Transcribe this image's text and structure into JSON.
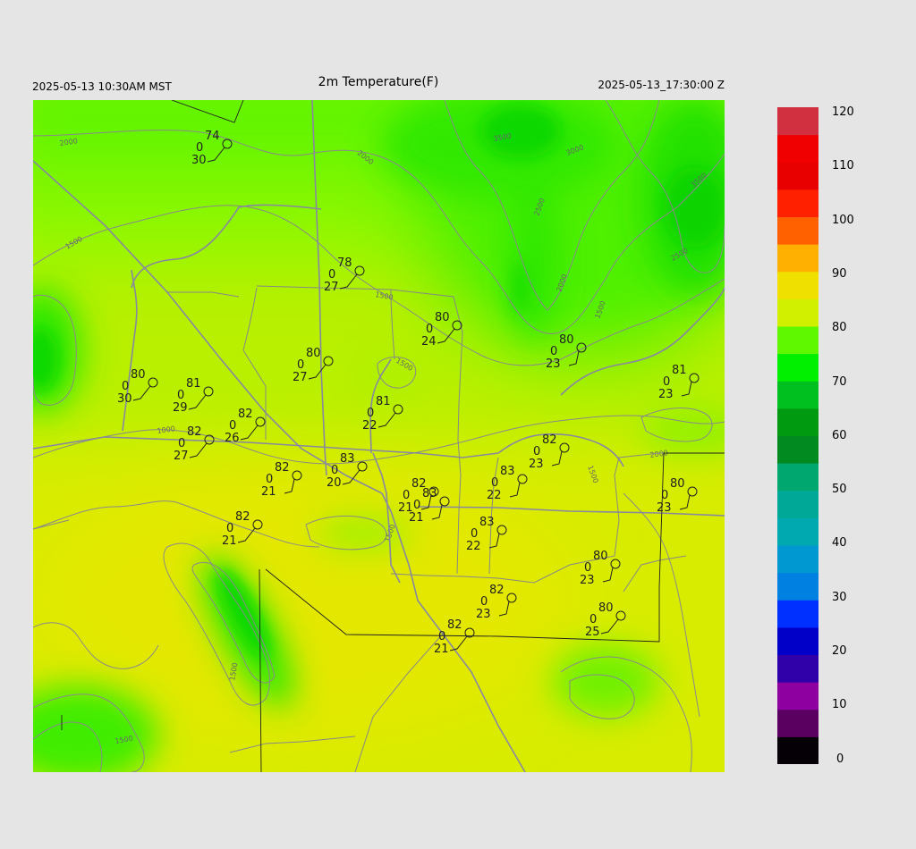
{
  "header": {
    "title": "2m Temperature(F)",
    "local_time": "2025-05-13 10:30AM MST",
    "utc_time": "2025-05-13_17:30:00 Z"
  },
  "colorbar": {
    "labels": [
      "120",
      "110",
      "100",
      "90",
      "80",
      "70",
      "60",
      "50",
      "40",
      "30",
      "20",
      "10",
      "0"
    ],
    "stops": [
      {
        "v": 0,
        "c": "#050005"
      },
      {
        "v": 5,
        "c": "#5a0060"
      },
      {
        "v": 10,
        "c": "#8e00a0"
      },
      {
        "v": 15,
        "c": "#3000a8"
      },
      {
        "v": 20,
        "c": "#0000c8"
      },
      {
        "v": 25,
        "c": "#0030ff"
      },
      {
        "v": 30,
        "c": "#0080e0"
      },
      {
        "v": 35,
        "c": "#0098d0"
      },
      {
        "v": 40,
        "c": "#00a8b0"
      },
      {
        "v": 45,
        "c": "#00a898"
      },
      {
        "v": 50,
        "c": "#00a870"
      },
      {
        "v": 55,
        "c": "#008a20"
      },
      {
        "v": 60,
        "c": "#009a10"
      },
      {
        "v": 65,
        "c": "#00c020"
      },
      {
        "v": 70,
        "c": "#00f000"
      },
      {
        "v": 75,
        "c": "#60f800"
      },
      {
        "v": 80,
        "c": "#d0f000"
      },
      {
        "v": 85,
        "c": "#f0e000"
      },
      {
        "v": 90,
        "c": "#ffb000"
      },
      {
        "v": 95,
        "c": "#ff6000"
      },
      {
        "v": 100,
        "c": "#ff2000"
      },
      {
        "v": 105,
        "c": "#e80000"
      },
      {
        "v": 110,
        "c": "#f00000"
      },
      {
        "v": 115,
        "c": "#d03040"
      },
      {
        "v": 120,
        "c": "#d0c8c8"
      }
    ]
  },
  "contours": [
    "2000",
    "1500",
    "2000",
    "3500",
    "3000",
    "2500",
    "2000",
    "1500",
    "1000",
    "1500",
    "1500",
    "1500",
    "1500",
    "2000",
    "3500",
    "2500",
    "1500",
    "1500"
  ],
  "stations": [
    {
      "t": "74",
      "v": "0",
      "td": "30"
    },
    {
      "t": "78",
      "v": "0",
      "td": "27"
    },
    {
      "t": "80",
      "v": "0",
      "td": "24"
    },
    {
      "t": "80",
      "v": "0",
      "td": "23"
    },
    {
      "t": "81",
      "v": "0",
      "td": "23"
    },
    {
      "t": "80",
      "v": "0",
      "td": "30"
    },
    {
      "t": "81",
      "v": "0",
      "td": "29"
    },
    {
      "t": "80",
      "v": "0",
      "td": "27"
    },
    {
      "t": "81",
      "v": "0",
      "td": "22"
    },
    {
      "t": "82",
      "v": "0",
      "td": "26"
    },
    {
      "t": "82",
      "v": "0",
      "td": "27"
    },
    {
      "t": "83",
      "v": "0",
      "td": "20"
    },
    {
      "t": "82",
      "v": "0",
      "td": "21"
    },
    {
      "t": "82",
      "v": "0",
      "td": "21"
    },
    {
      "t": "82",
      "v": "0",
      "td": "23"
    },
    {
      "t": "83",
      "v": "0",
      "td": "22"
    },
    {
      "t": "83",
      "v": "0",
      "td": "21"
    },
    {
      "t": "82",
      "v": "0",
      "td": "21"
    },
    {
      "t": "83",
      "v": "0",
      "td": "22"
    },
    {
      "t": "80",
      "v": "0",
      "td": "23"
    },
    {
      "t": "80",
      "v": "0",
      "td": "23"
    },
    {
      "t": "82",
      "v": "0",
      "td": "23"
    },
    {
      "t": "80",
      "v": "0",
      "td": "25"
    },
    {
      "t": "82",
      "v": "0",
      "td": "21"
    }
  ]
}
